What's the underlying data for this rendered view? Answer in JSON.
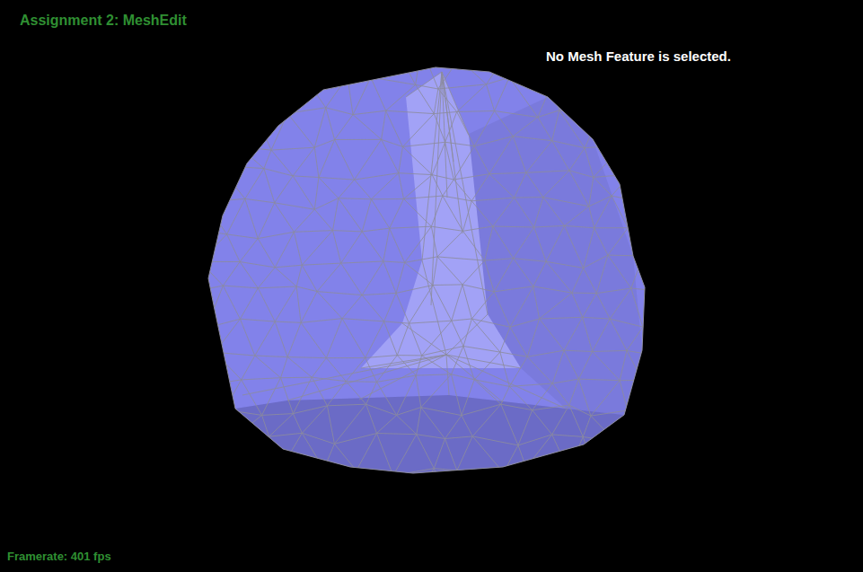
{
  "app_title": "Assignment 2: MeshEdit",
  "selection_status": "No Mesh Feature is selected.",
  "framerate": "Framerate: 401 fps"
}
